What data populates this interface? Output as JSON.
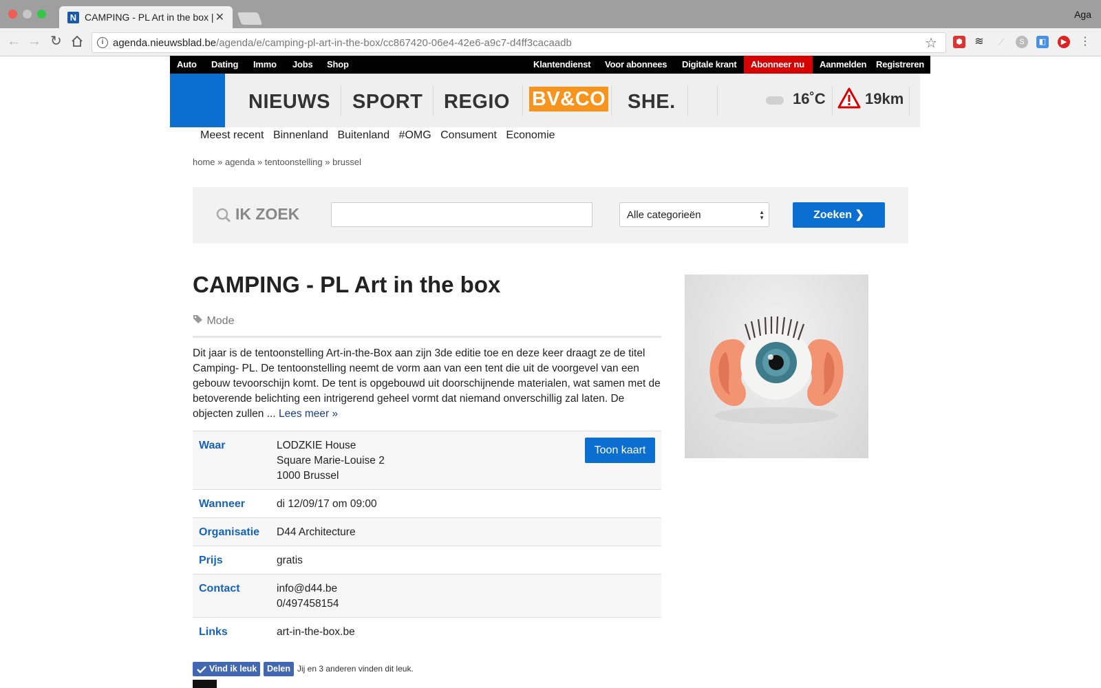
{
  "browser": {
    "tab_title": "CAMPING - PL Art in the box |",
    "tab_favicon": "N",
    "url_host": "agenda.nieuwsblad.be",
    "url_path": "/agenda/e/camping-pl-art-in-the-box/cc867420-06e4-42e6-a9c7-d4ff3cacaadb",
    "profile_name": "Aga",
    "icons": [
      "back-icon",
      "forward-icon",
      "reload-icon",
      "home-icon",
      "info-icon",
      "star-icon"
    ]
  },
  "topbar": {
    "left": [
      "Auto",
      "Dating",
      "Immo",
      "Jobs",
      "Shop"
    ],
    "right": [
      "Klantendienst",
      "Voor abonnees",
      "Digitale krant",
      "Abonneer nu",
      "Aanmelden",
      "Registreren"
    ]
  },
  "header": {
    "sections": [
      "NIEUWS",
      "SPORT",
      "REGIO",
      "BV&CO",
      "SHE."
    ],
    "temperature": "16˚C",
    "traffic": "19km",
    "accent_color": "#0b6fd1",
    "bvco_color": "#f7941d"
  },
  "subnav": [
    "Meest recent",
    "Binnenland",
    "Buitenland",
    "#OMG",
    "Consument",
    "Economie"
  ],
  "breadcrumb": "home » agenda » tentoonstelling » brussel",
  "search": {
    "label": "IK ZOEK",
    "value": "",
    "category": "Alle categorieën",
    "button": "Zoeken ❯"
  },
  "event": {
    "title": "CAMPING - PL Art in the box",
    "tag": "Mode",
    "description": "Dit jaar is de tentoonstelling Art-in-the-Box aan zijn 3de editie toe en deze keer draagt ze de titel Camping- PL. De tentoonstelling neemt de vorm aan van een tent die uit de voorgevel van een gebouw tevoorschijn komt. De tent is opgebouwd uit doorschijnende materialen, wat samen met de betoverende belichting een intrigerend geheel vormt dat niemand onverschillig zal laten. De objecten zullen ...",
    "read_more": "Lees meer »",
    "details": {
      "waar_label": "Waar",
      "waar_lines": [
        "LODZKIE House",
        "Square Marie-Louise 2",
        "1000 Brussel"
      ],
      "map_button": "Toon kaart",
      "wanneer_label": "Wanneer",
      "wanneer": "di 12/09/17 om 09:00",
      "organisatie_label": "Organisatie",
      "organisatie": "D44 Architecture",
      "prijs_label": "Prijs",
      "prijs": "gratis",
      "contact_label": "Contact",
      "contact_lines": [
        "info@d44.be",
        "0/497458154"
      ],
      "links_label": "Links",
      "links": "art-in-the-box.be"
    }
  },
  "social": {
    "like": "Vind ik leuk",
    "share": "Delen",
    "text": "Jij en 3 anderen vinden dit leuk."
  }
}
